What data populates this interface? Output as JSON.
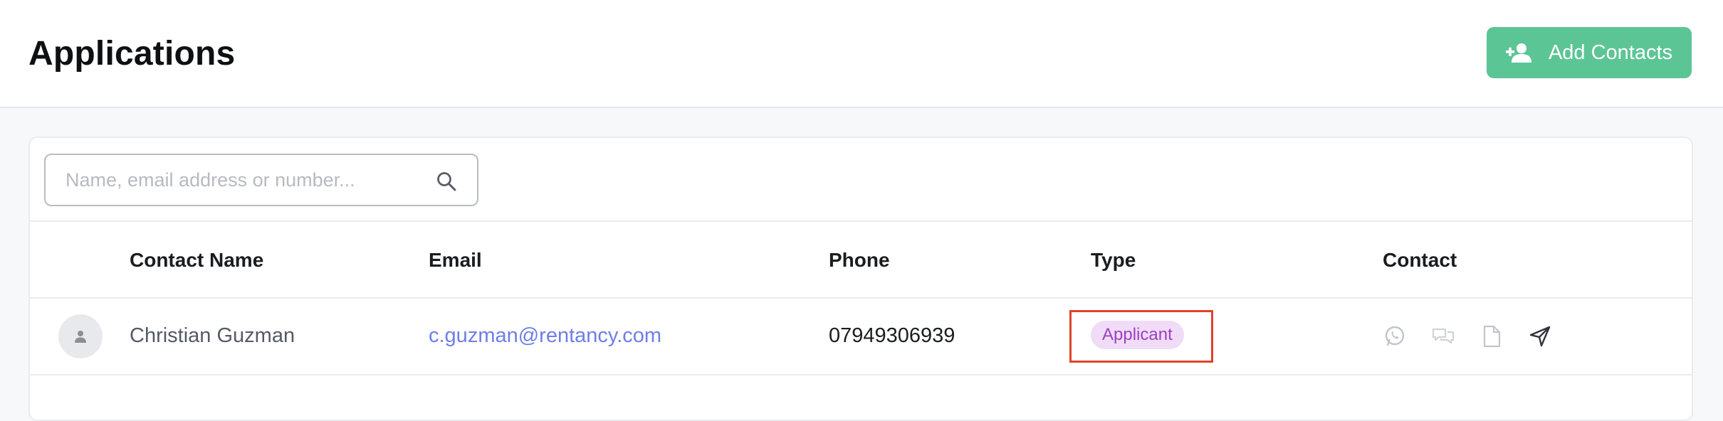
{
  "header": {
    "title": "Applications",
    "add_button_label": "Add Contacts"
  },
  "search": {
    "placeholder": "Name, email address or number..."
  },
  "table": {
    "columns": [
      "Contact Name",
      "Email",
      "Phone",
      "Type",
      "Contact"
    ],
    "rows": [
      {
        "name": "Christian Guzman",
        "email": "c.guzman@rentancy.com",
        "phone": "07949306939",
        "type": "Applicant",
        "contact_icons": [
          "whatsapp-icon",
          "chat-icon",
          "document-icon",
          "send-icon"
        ]
      }
    ]
  },
  "colors": {
    "accent_green": "#5cc595",
    "link_blue": "#6e7ee8",
    "badge_bg": "#f0dcf7",
    "badge_text": "#9d3fc3",
    "highlight_red": "#e0432a"
  }
}
